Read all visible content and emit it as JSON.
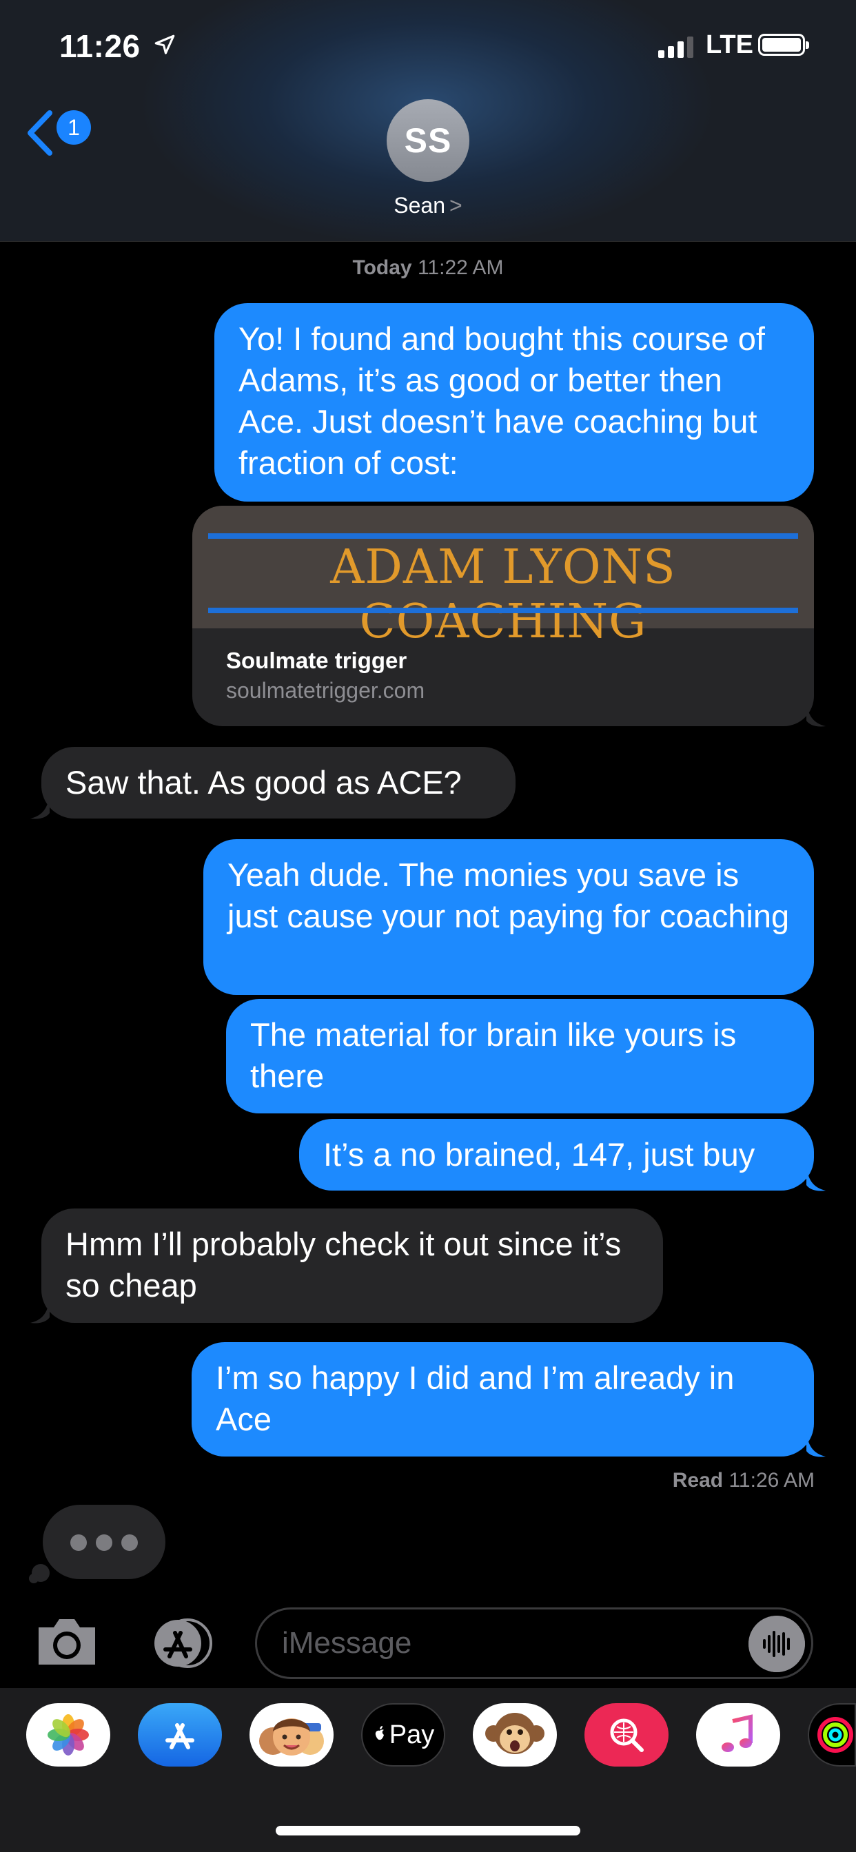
{
  "status_bar": {
    "time": "11:26",
    "network": "LTE"
  },
  "header": {
    "back_badge_count": "1",
    "contact_initials": "SS",
    "contact_name": "Sean",
    "name_chevron": ">"
  },
  "thread": {
    "timestamp_day": "Today",
    "timestamp_time": "11:22 AM",
    "messages": [
      {
        "direction": "sent",
        "text": "Yo! I found and bought this course of Adams, it’s as good or better then Ace. Just doesn’t have coaching but fraction of cost:"
      },
      {
        "direction": "sent",
        "type": "link",
        "banner_text": "ADAM LYONS COACHING",
        "title": "Soulmate trigger",
        "url": "soulmatetrigger.com"
      },
      {
        "direction": "received",
        "text": "Saw that. As good as ACE?"
      },
      {
        "direction": "sent",
        "text": "Yeah dude. The monies you save is just cause your not paying for coaching"
      },
      {
        "direction": "sent",
        "text": "The material for brain like yours is there"
      },
      {
        "direction": "sent",
        "text": "It’s a no brained, 147, just buy"
      },
      {
        "direction": "received",
        "text": "Hmm I’ll probably check it out since it’s so cheap"
      },
      {
        "direction": "sent",
        "text": "I’m so happy I did and I’m already in Ace"
      }
    ],
    "read_label": "Read",
    "read_time": "11:26 AM"
  },
  "input_bar": {
    "placeholder": "iMessage"
  },
  "app_drawer": {
    "apps": [
      "photos-icon",
      "app-store-icon",
      "memoji-icon",
      "apple-pay-icon",
      "animoji-icon",
      "image-search-icon",
      "music-icon",
      "activity-icon"
    ],
    "apple_pay_label": "Pay"
  },
  "colors": {
    "sent_bubble": "#1d8afe",
    "received_bubble": "#262628",
    "accent": "#1a84ff"
  }
}
